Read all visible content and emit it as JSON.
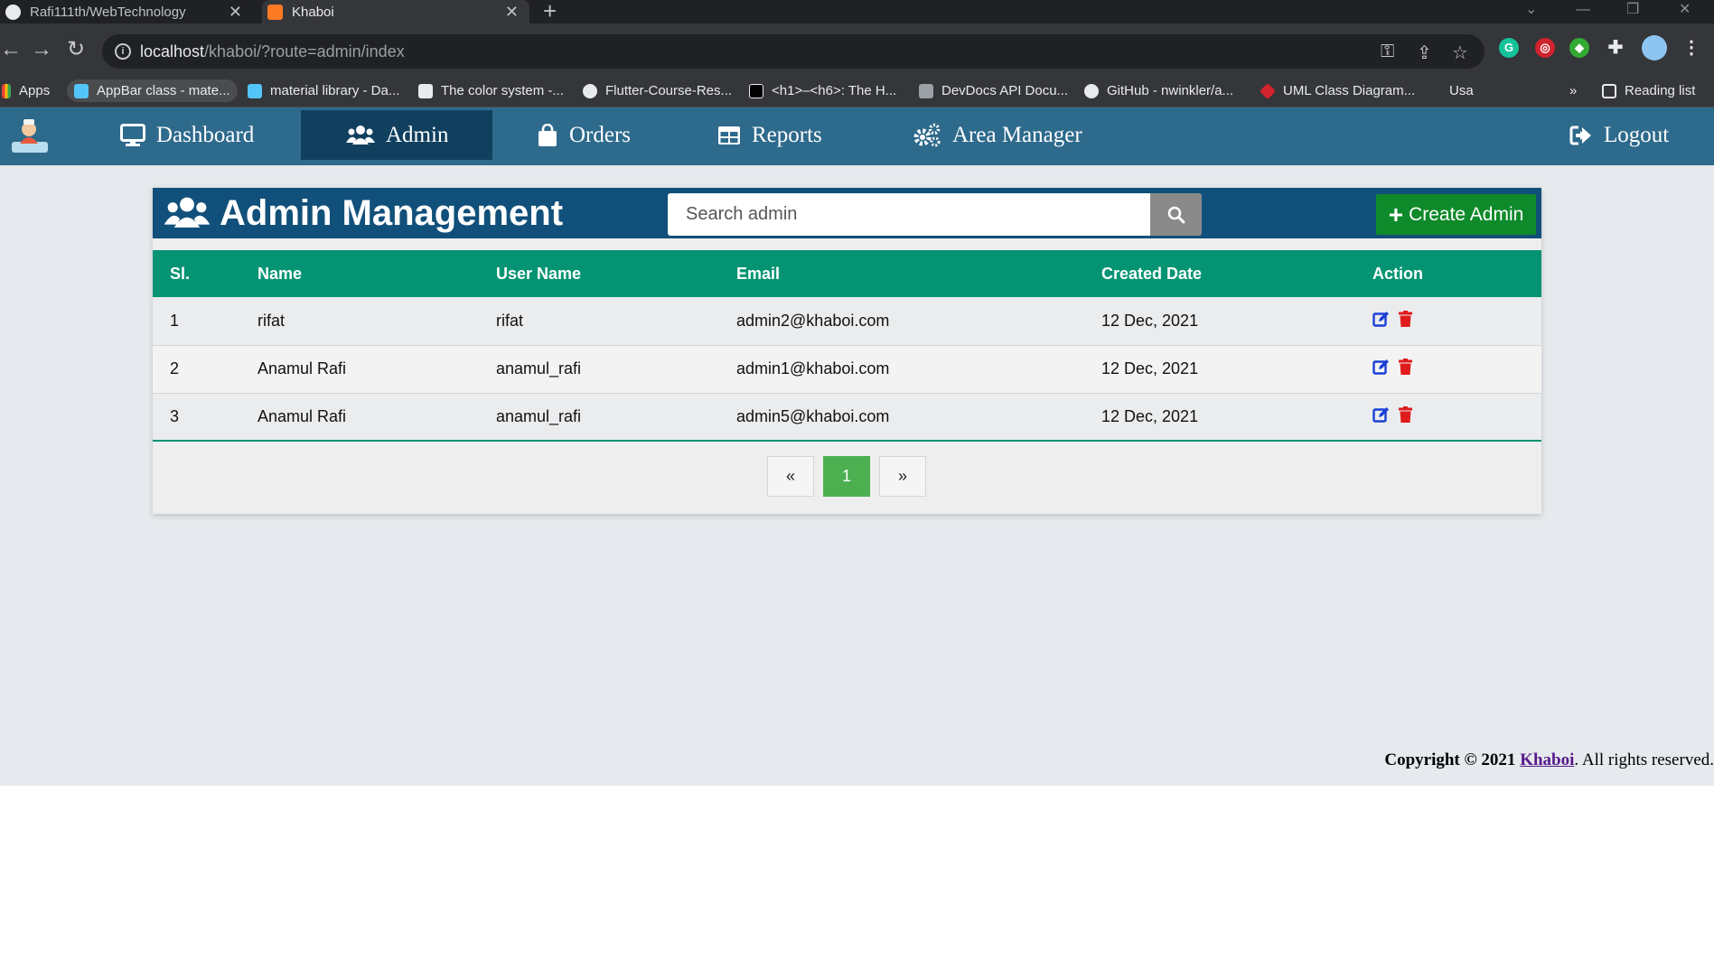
{
  "browser": {
    "tabs": [
      {
        "title": "Rafi111th/WebTechnology",
        "active": false
      },
      {
        "title": "Khaboi",
        "active": true
      }
    ],
    "new_tab": "+",
    "url_host": "localhost",
    "url_path": "/khaboi/?route=admin/index",
    "bookmarks": [
      {
        "label": "Apps",
        "icon": "apps-icon"
      },
      {
        "label": "AppBar class - mate...",
        "icon": "flutter-icon"
      },
      {
        "label": "material library - Da...",
        "icon": "flutter-icon"
      },
      {
        "label": "The color system -...",
        "icon": "material-icon"
      },
      {
        "label": "Flutter-Course-Res...",
        "icon": "github-icon"
      },
      {
        "label": "<h1>–<h6>: The H...",
        "icon": "mdn-icon"
      },
      {
        "label": "DevDocs API Docu...",
        "icon": "devdocs-icon"
      },
      {
        "label": "GitHub - nwinkler/a...",
        "icon": "github-icon"
      },
      {
        "label": "UML Class Diagram...",
        "icon": "uml-icon"
      },
      {
        "label": "Usa",
        "icon": "usa-icon"
      }
    ],
    "bookmarks_overflow": "»",
    "reading_list": "Reading list"
  },
  "nav": {
    "items": [
      {
        "label": "Dashboard",
        "icon": "monitor-icon",
        "active": false
      },
      {
        "label": "Admin",
        "icon": "users-icon",
        "active": true
      },
      {
        "label": "Orders",
        "icon": "shopping-bag-icon",
        "active": false
      },
      {
        "label": "Reports",
        "icon": "table-icon",
        "active": false
      },
      {
        "label": "Area Manager",
        "icon": "cogs-icon",
        "active": false
      }
    ],
    "logout": "Logout"
  },
  "panel": {
    "title": "Admin Management",
    "search_placeholder": "Search admin",
    "create_label": "Create Admin"
  },
  "table": {
    "headers": [
      "Sl.",
      "Name",
      "User Name",
      "Email",
      "Created Date",
      "Action"
    ],
    "rows": [
      {
        "sl": "1",
        "name": "rifat",
        "username": "rifat",
        "email": "admin2@khaboi.com",
        "created": "12 Dec, 2021"
      },
      {
        "sl": "2",
        "name": "Anamul Rafi",
        "username": "anamul_rafi",
        "email": "admin1@khaboi.com",
        "created": "12 Dec, 2021"
      },
      {
        "sl": "3",
        "name": "Anamul Rafi",
        "username": "anamul_rafi",
        "email": "admin5@khaboi.com",
        "created": "12 Dec, 2021"
      }
    ]
  },
  "pagination": {
    "prev": "«",
    "current": "1",
    "next": "»"
  },
  "footer": {
    "lead": "Copyright © 2021",
    "brand": "Khaboi",
    "tail": ". All rights reserved."
  },
  "colors": {
    "nav": "#2e6a8c",
    "nav_active": "#11405f",
    "panel_header": "#11507a",
    "table_header": "#049473",
    "create": "#0f8a2a",
    "page_active": "#4caf50",
    "edit": "#1a3fd6",
    "delete": "#e01b1b"
  }
}
